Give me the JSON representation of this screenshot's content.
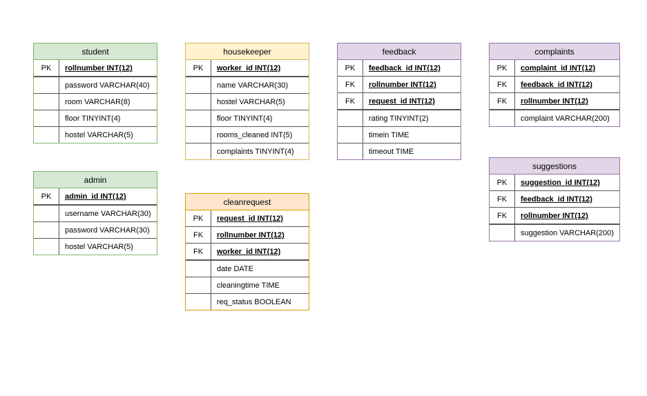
{
  "tables": {
    "student": {
      "title": "student",
      "rows": [
        {
          "key": "PK",
          "field": "rollnumber INT(12)",
          "pkfk": true,
          "sep": true
        },
        {
          "key": "",
          "field": "password VARCHAR(40)"
        },
        {
          "key": "",
          "field": "room VARCHAR(8)"
        },
        {
          "key": "",
          "field": "floor TINYINT(4)"
        },
        {
          "key": "",
          "field": "hostel VARCHAR(5)"
        }
      ]
    },
    "admin": {
      "title": "admin",
      "rows": [
        {
          "key": "PK",
          "field": "admin_id INT(12)",
          "pkfk": true,
          "sep": true
        },
        {
          "key": "",
          "field": "username VARCHAR(30)"
        },
        {
          "key": "",
          "field": "password VARCHAR(30)"
        },
        {
          "key": "",
          "field": "hostel VARCHAR(5)"
        }
      ]
    },
    "housekeeper": {
      "title": "housekeeper",
      "rows": [
        {
          "key": "PK",
          "field": "worker_id INT(12)",
          "pkfk": true,
          "sep": true
        },
        {
          "key": "",
          "field": "name VARCHAR(30)"
        },
        {
          "key": "",
          "field": "hostel VARCHAR(5)"
        },
        {
          "key": "",
          "field": "floor TINYINT(4)"
        },
        {
          "key": "",
          "field": "rooms_cleaned INT(5)"
        },
        {
          "key": "",
          "field": "complaints TINYINT(4)"
        }
      ]
    },
    "cleanrequest": {
      "title": "cleanrequest",
      "rows": [
        {
          "key": "PK",
          "field": "request_id INT(12)",
          "pkfk": true
        },
        {
          "key": "FK",
          "field": "rollnumber INT(12)",
          "pkfk": true
        },
        {
          "key": "FK",
          "field": "worker_id INT(12)",
          "pkfk": true,
          "sep": true
        },
        {
          "key": "",
          "field": "date DATE"
        },
        {
          "key": "",
          "field": "cleaningtime TIME"
        },
        {
          "key": "",
          "field": "req_status BOOLEAN"
        }
      ]
    },
    "feedback": {
      "title": "feedback",
      "rows": [
        {
          "key": "PK",
          "field": "feedback_id INT(12)",
          "pkfk": true
        },
        {
          "key": "FK",
          "field": "rollnumber INT(12)",
          "pkfk": true
        },
        {
          "key": "FK",
          "field": "request_id INT(12)",
          "pkfk": true,
          "sep": true
        },
        {
          "key": "",
          "field": "rating TINYINT(2)"
        },
        {
          "key": "",
          "field": "timein TIME"
        },
        {
          "key": "",
          "field": "timeout TIME"
        }
      ]
    },
    "complaints": {
      "title": "complaints",
      "rows": [
        {
          "key": "PK",
          "field": "complaint_id INT(12)",
          "pkfk": true
        },
        {
          "key": "FK",
          "field": "feedback_id INT(12)",
          "pkfk": true
        },
        {
          "key": "FK",
          "field": "rollnumber INT(12)",
          "pkfk": true,
          "sep": true
        },
        {
          "key": "",
          "field": "complaint VARCHAR(200)"
        }
      ]
    },
    "suggestions": {
      "title": "suggestions",
      "rows": [
        {
          "key": "PK",
          "field": "suggestion_id INT(12)",
          "pkfk": true
        },
        {
          "key": "FK",
          "field": "feedback_id INT(12)",
          "pkfk": true
        },
        {
          "key": "FK",
          "field": "rollnumber INT(12)",
          "pkfk": true,
          "sep": true
        },
        {
          "key": "",
          "field": "suggestion VARCHAR(200)"
        }
      ]
    }
  },
  "chart_data": {
    "type": "table",
    "description": "Database schema diagram with 7 entities",
    "entities": [
      {
        "name": "student",
        "color": "green",
        "columns": [
          {
            "key": "PK",
            "name": "rollnumber",
            "type": "INT(12)"
          },
          {
            "name": "password",
            "type": "VARCHAR(40)"
          },
          {
            "name": "room",
            "type": "VARCHAR(8)"
          },
          {
            "name": "floor",
            "type": "TINYINT(4)"
          },
          {
            "name": "hostel",
            "type": "VARCHAR(5)"
          }
        ]
      },
      {
        "name": "admin",
        "color": "green",
        "columns": [
          {
            "key": "PK",
            "name": "admin_id",
            "type": "INT(12)"
          },
          {
            "name": "username",
            "type": "VARCHAR(30)"
          },
          {
            "name": "password",
            "type": "VARCHAR(30)"
          },
          {
            "name": "hostel",
            "type": "VARCHAR(5)"
          }
        ]
      },
      {
        "name": "housekeeper",
        "color": "yellow",
        "columns": [
          {
            "key": "PK",
            "name": "worker_id",
            "type": "INT(12)"
          },
          {
            "name": "name",
            "type": "VARCHAR(30)"
          },
          {
            "name": "hostel",
            "type": "VARCHAR(5)"
          },
          {
            "name": "floor",
            "type": "TINYINT(4)"
          },
          {
            "name": "rooms_cleaned",
            "type": "INT(5)"
          },
          {
            "name": "complaints",
            "type": "TINYINT(4)"
          }
        ]
      },
      {
        "name": "cleanrequest",
        "color": "orange",
        "columns": [
          {
            "key": "PK",
            "name": "request_id",
            "type": "INT(12)"
          },
          {
            "key": "FK",
            "name": "rollnumber",
            "type": "INT(12)"
          },
          {
            "key": "FK",
            "name": "worker_id",
            "type": "INT(12)"
          },
          {
            "name": "date",
            "type": "DATE"
          },
          {
            "name": "cleaningtime",
            "type": "TIME"
          },
          {
            "name": "req_status",
            "type": "BOOLEAN"
          }
        ]
      },
      {
        "name": "feedback",
        "color": "purple",
        "columns": [
          {
            "key": "PK",
            "name": "feedback_id",
            "type": "INT(12)"
          },
          {
            "key": "FK",
            "name": "rollnumber",
            "type": "INT(12)"
          },
          {
            "key": "FK",
            "name": "request_id",
            "type": "INT(12)"
          },
          {
            "name": "rating",
            "type": "TINYINT(2)"
          },
          {
            "name": "timein",
            "type": "TIME"
          },
          {
            "name": "timeout",
            "type": "TIME"
          }
        ]
      },
      {
        "name": "complaints",
        "color": "purple",
        "columns": [
          {
            "key": "PK",
            "name": "complaint_id",
            "type": "INT(12)"
          },
          {
            "key": "FK",
            "name": "feedback_id",
            "type": "INT(12)"
          },
          {
            "key": "FK",
            "name": "rollnumber",
            "type": "INT(12)"
          },
          {
            "name": "complaint",
            "type": "VARCHAR(200)"
          }
        ]
      },
      {
        "name": "suggestions",
        "color": "purple",
        "columns": [
          {
            "key": "PK",
            "name": "suggestion_id",
            "type": "INT(12)"
          },
          {
            "key": "FK",
            "name": "feedback_id",
            "type": "INT(12)"
          },
          {
            "key": "FK",
            "name": "rollnumber",
            "type": "INT(12)"
          },
          {
            "name": "suggestion",
            "type": "VARCHAR(200)"
          }
        ]
      }
    ]
  }
}
